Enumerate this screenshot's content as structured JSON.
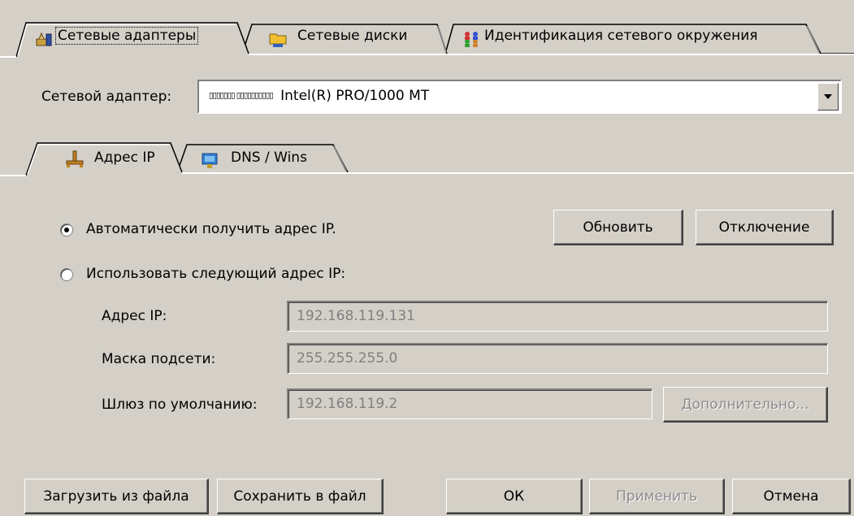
{
  "tabs": [
    {
      "label": "Сетевые адаптеры",
      "icon": "network-adapter-icon",
      "active": true
    },
    {
      "label": "Сетевые диски",
      "icon": "network-drive-icon",
      "active": false
    },
    {
      "label": "Идентификация сетевого окружения",
      "icon": "network-identification-icon",
      "active": false
    }
  ],
  "adapter": {
    "label": "Сетевой адаптер:",
    "prefix": "▯▯▯▯▯▯▯ ▯▯▯▯▯▯▯▯▯▯",
    "name": "Intel(R) PRO/1000 MT"
  },
  "subtabs": [
    {
      "label": "Адрес IP",
      "icon": "ip-address-icon",
      "active": true
    },
    {
      "label": "DNS / Wins",
      "icon": "dns-wins-icon",
      "active": false
    }
  ],
  "ip": {
    "auto_label": "Автоматически получить адрес IP.",
    "auto_selected": true,
    "manual_label": "Использовать следующий адрес IP:",
    "refresh_button": "Обновить",
    "disconnect_button": "Отключение",
    "address_label": "Адрес IP:",
    "address_value": "192.168.119.131",
    "mask_label": "Маска подсети:",
    "mask_value": "255.255.255.0",
    "gateway_label": "Шлюз по умолчанию:",
    "gateway_value": "192.168.119.2",
    "advanced_button": "Дополнительно..."
  },
  "footer": {
    "load_button": "Загрузить из файла",
    "save_button": "Сохранить в файл",
    "ok_button": "ОК",
    "apply_button": "Применить",
    "cancel_button": "Отмена"
  },
  "colors": {
    "face": "#d4d0c8",
    "shadow": "#808080",
    "highlight": "#ffffff",
    "disabled_text": "#808080"
  }
}
